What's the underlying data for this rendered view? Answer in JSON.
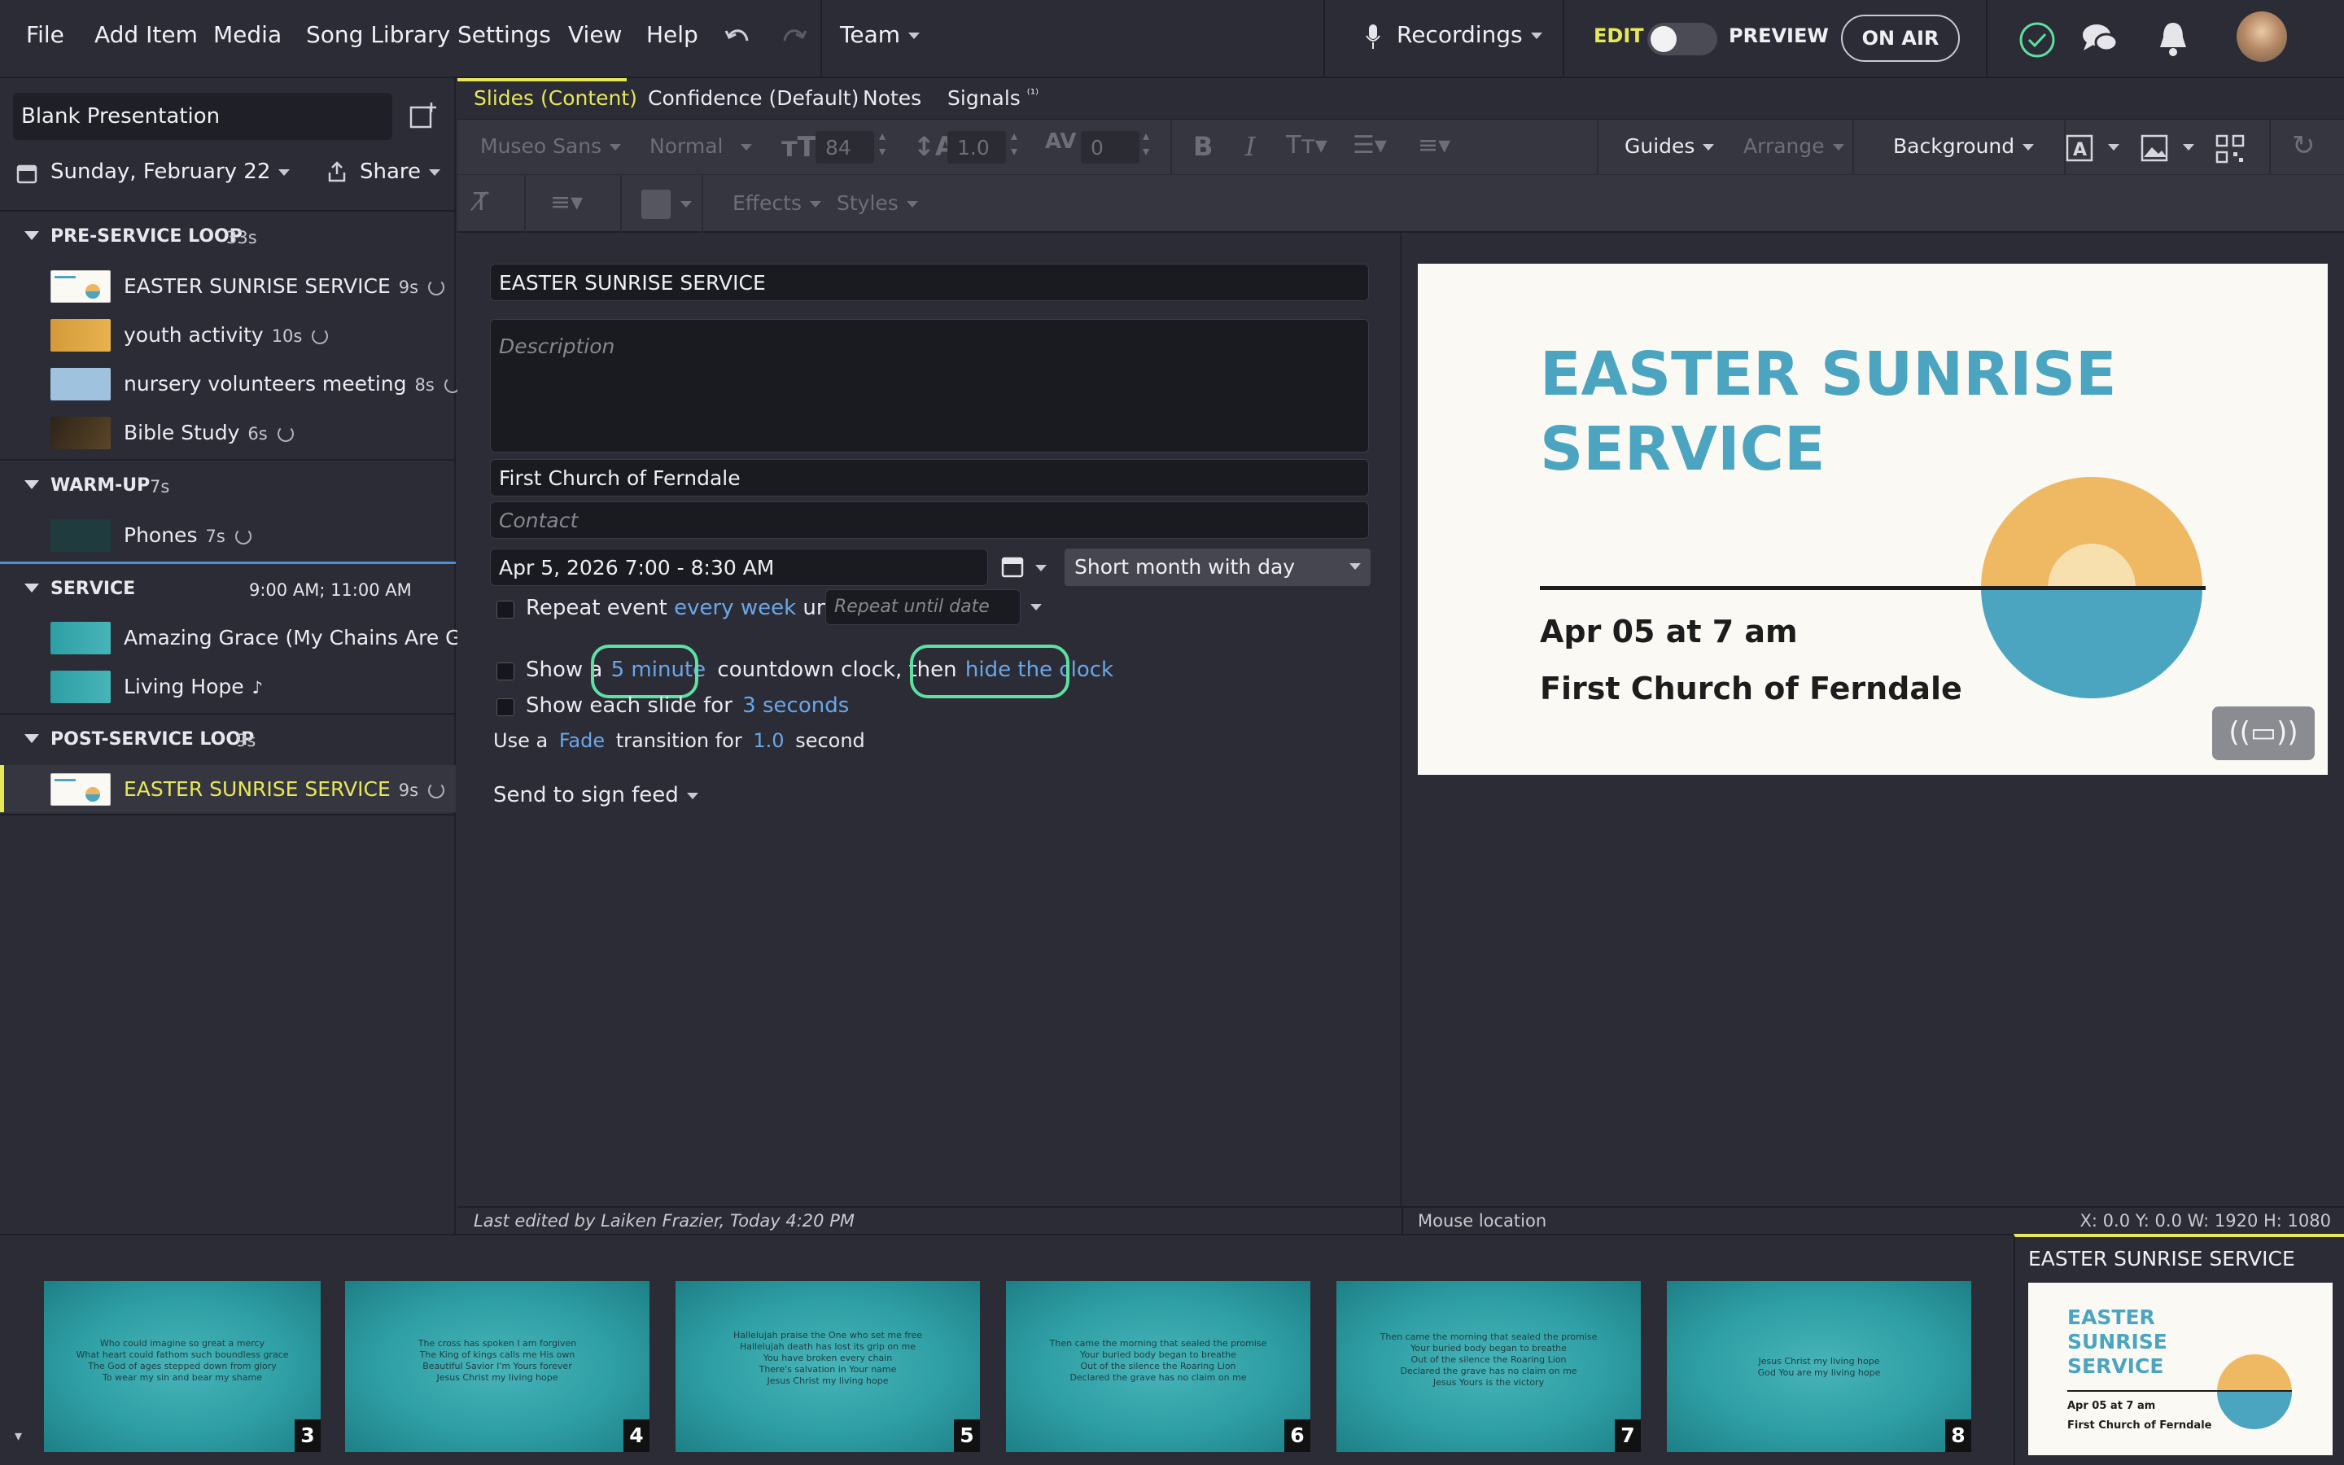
{
  "menu": {
    "file": "File",
    "add_item": "Add Item",
    "media": "Media",
    "song_library": "Song Library",
    "settings": "Settings",
    "view": "View",
    "help": "Help",
    "team": "Team",
    "recordings": "Recordings",
    "edit": "EDIT",
    "preview": "PREVIEW",
    "on_air": "ON AIR"
  },
  "sidebar": {
    "presentation_title": "Blank Presentation",
    "date": "Sunday, February 22",
    "share": "Share",
    "sections": [
      {
        "name": "PRE-SERVICE LOOP",
        "duration": "33s",
        "items": [
          {
            "label": "EASTER SUNRISE SERVICE",
            "duration": "9s"
          },
          {
            "label": "youth activity",
            "duration": "10s"
          },
          {
            "label": "nursery volunteers meeting",
            "duration": "8s"
          },
          {
            "label": "Bible Study",
            "duration": "6s"
          }
        ]
      },
      {
        "name": "WARM-UP",
        "duration": "7s",
        "items": [
          {
            "label": "Phones",
            "duration": "7s"
          }
        ]
      },
      {
        "name": "SERVICE",
        "duration": "9:00 AM; 11:00 AM",
        "items": [
          {
            "label": "Amazing Grace (My Chains Are G...",
            "duration": "♪"
          },
          {
            "label": "Living Hope",
            "duration": "♪"
          }
        ]
      },
      {
        "name": "POST-SERVICE LOOP",
        "duration": "9s",
        "items": [
          {
            "label": "EASTER SUNRISE SERVICE",
            "duration": "9s"
          }
        ]
      }
    ]
  },
  "tabs": {
    "slides": "Slides (Content)",
    "confidence": "Confidence (Default)",
    "notes": "Notes",
    "signals": "Signals",
    "signals_badge": "⁽¹⁾"
  },
  "toolbar": {
    "font": "Museo Sans",
    "weight": "Normal",
    "size": "84",
    "line_height": "1.0",
    "spacing": "0",
    "guides": "Guides",
    "arrange": "Arrange",
    "background": "Background",
    "effects": "Effects",
    "styles": "Styles"
  },
  "editor": {
    "title": "EASTER SUNRISE SERVICE",
    "description_placeholder": "Description",
    "location": "First Church of Ferndale",
    "contact_placeholder": "Contact",
    "datetime": "Apr 5, 2026 7:00 - 8:30 AM",
    "date_format": "Short month with day",
    "repeat_label": "Repeat event",
    "repeat_freq": "every week",
    "until": "until",
    "repeat_until_placeholder": "Repeat until date",
    "show_a": "Show a",
    "minutes": "5 minute",
    "countdown": "countdown clock, then",
    "hide_clock": "hide the clock",
    "show_each": "Show each slide for",
    "seconds": "3 seconds",
    "use_a": "Use a",
    "transition": "Fade",
    "transition_for": "transition for",
    "transition_duration": "1.0",
    "second": "second",
    "sign_feed": "Send to sign feed"
  },
  "slide": {
    "title_line1": "EASTER SUNRISE",
    "title_line2": "SERVICE",
    "date": "Apr 05 at 7 am",
    "location": "First Church of Ferndale",
    "broadcast_icon": "((▭))"
  },
  "status": {
    "last_edited": "Last edited by Laiken Frazier, Today 4:20 PM",
    "mouse_location": "Mouse location",
    "coords": "X: 0.0  Y: 0.0    W: 1920  H: 1080"
  },
  "filmstrip": [
    {
      "num": "3",
      "lyrics": "Who could imagine so great a mercy\nWhat heart could fathom such boundless grace\nThe God of ages stepped down from glory\nTo wear my sin and bear my shame"
    },
    {
      "num": "4",
      "lyrics": "The cross has spoken I am forgiven\nThe King of kings calls me His own\nBeautiful Savior I'm Yours forever\nJesus Christ my living hope"
    },
    {
      "num": "5",
      "lyrics": "Hallelujah praise the One who set me free\nHallelujah death has lost its grip on me\nYou have broken every chain\nThere's salvation in Your name\nJesus Christ my living hope"
    },
    {
      "num": "6",
      "lyrics": "Then came the morning that sealed the promise\nYour buried body began to breathe\nOut of the silence the Roaring Lion\nDeclared the grave has no claim on me"
    },
    {
      "num": "7",
      "lyrics": "Then came the morning that sealed the promise\nYour buried body began to breathe\nOut of the silence the Roaring Lion\nDeclared the grave has no claim on me\nJesus Yours is the victory"
    },
    {
      "num": "8",
      "lyrics": "Jesus Christ my living hope\nGod You are my living hope"
    }
  ],
  "live_panel": {
    "title": "EASTER SUNRISE SERVICE",
    "mini_title": "EASTER SUNRISE SERVICE",
    "mini_date": "Apr 05 at 7 am",
    "mini_location": "First Church of Ferndale"
  },
  "colors": {
    "accent": "#e6e85a",
    "link": "#6aa7e8",
    "highlight": "#5fe0a3",
    "slide_title": "#4ba5c0"
  }
}
